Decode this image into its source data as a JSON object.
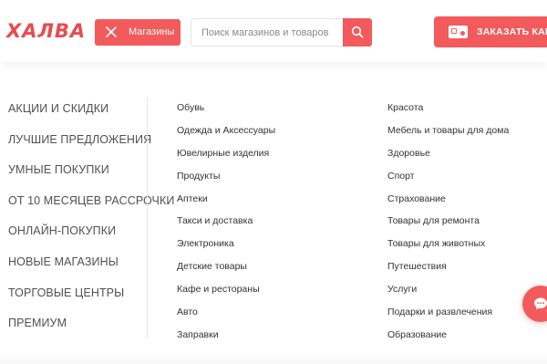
{
  "header": {
    "logo": "ХАЛВА",
    "stores_label": "Магазины",
    "search_placeholder": "Поиск магазинов и товаров",
    "order_label": "ЗАКАЗАТЬ КАРТУ"
  },
  "left_menu": [
    "АКЦИИ И СКИДКИ",
    "ЛУЧШИЕ ПРЕДЛОЖЕНИЯ",
    "УМНЫЕ ПОКУПКИ",
    "ОТ 10 МЕСЯЦЕВ РАССРОЧКИ",
    "ОНЛАЙН-ПОКУПКИ",
    "НОВЫЕ МАГАЗИНЫ",
    "ТОРГОВЫЕ ЦЕНТРЫ",
    "ПРЕМИУМ"
  ],
  "categories_col1": [
    "Обувь",
    "Одежда и Аксессуары",
    "Ювелирные изделия",
    "Продукты",
    "Аптеки",
    "Такси и доставка",
    "Электроника",
    "Детские товары",
    "Кафе и рестораны",
    "Авто",
    "Заправки"
  ],
  "categories_col2": [
    "Красота",
    "Мебель и товары для дома",
    "Здоровье",
    "Спорт",
    "Страхование",
    "Товары для ремонта",
    "Товары для животных",
    "Путешествия",
    "Услуги",
    "Подарки и развлечения",
    "Образование"
  ],
  "colors": {
    "accent": "#f35a5c",
    "logo": "#e94b4f"
  },
  "icons": {
    "stores": "close-icon",
    "search": "search-icon",
    "order": "card-icon",
    "chat": "chat-icon"
  }
}
